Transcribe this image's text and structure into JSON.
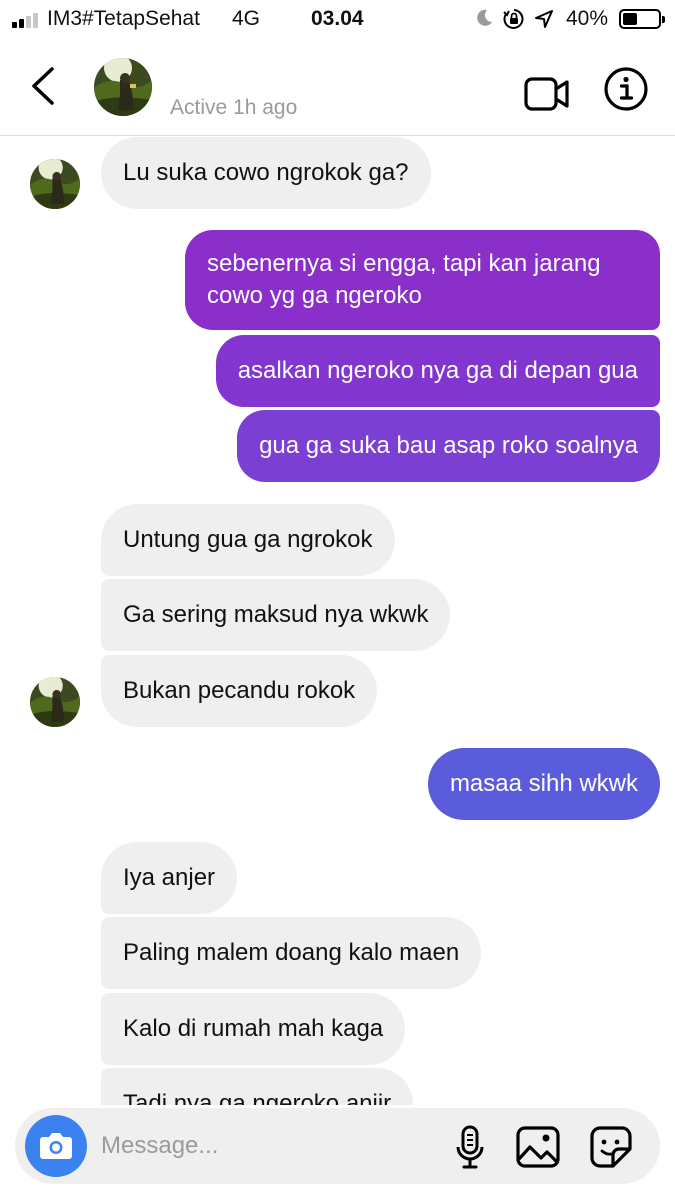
{
  "status_bar": {
    "carrier": "IM3#TetapSehat",
    "network": "4G",
    "time": "03.04",
    "battery_percent": "40%",
    "battery_level": 0.4,
    "icons": [
      "signal-icon",
      "moon-icon",
      "orientation-lock-icon",
      "location-arrow-icon",
      "battery-icon"
    ]
  },
  "header": {
    "active_status": "Active 1h ago",
    "icons": [
      "back-chevron-icon",
      "video-camera-icon",
      "info-icon"
    ]
  },
  "messages": {
    "incoming_1": "Lu suka cowo ngrokok ga?",
    "outgoing_1": "sebenernya si engga, tapi kan jarang cowo yg ga ngeroko",
    "outgoing_2": "asalkan ngeroko nya ga di depan gua",
    "outgoing_3": "gua ga suka bau asap roko soalnya",
    "incoming_2": "Untung gua ga ngrokok",
    "incoming_3": "Ga sering maksud nya wkwk",
    "incoming_4": "Bukan pecandu rokok",
    "outgoing_4": "masaa sihh wkwk",
    "incoming_5": "Iya anjer",
    "incoming_6": "Paling malem doang kalo maen",
    "incoming_7": "Kalo di rumah mah kaga",
    "incoming_8": "Tadi nya ga ngeroko anjir"
  },
  "composer": {
    "placeholder": "Message...",
    "icons": [
      "camera-icon",
      "microphone-icon",
      "gallery-icon",
      "sticker-icon"
    ]
  },
  "colors": {
    "incoming_bubble": "#efefef",
    "outgoing_purple": "#8a2fc9",
    "outgoing_violet": "#7b40d3",
    "outgoing_blue": "#5a5cdc",
    "camera_button": "#3b82f0"
  }
}
